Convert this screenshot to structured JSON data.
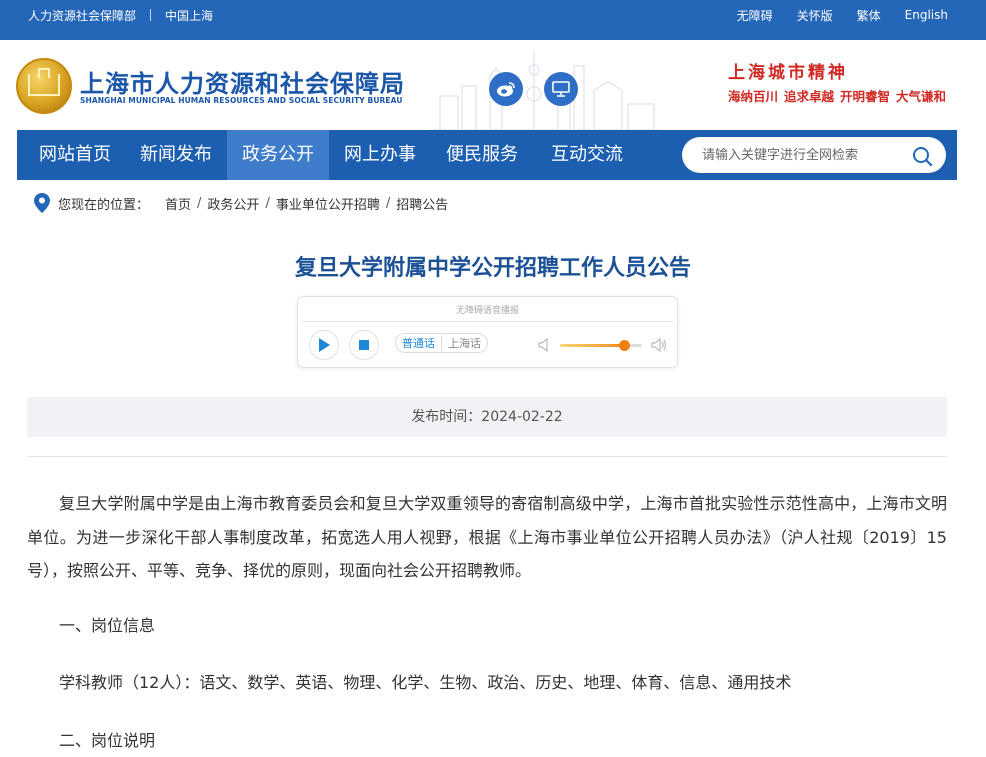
{
  "topbar": {
    "left": [
      "人力资源社会保障部",
      "中国上海"
    ],
    "right": [
      "无障碍",
      "关怀版",
      "繁体",
      "English"
    ]
  },
  "header": {
    "title": "上海市人力资源和社会保障局",
    "subtitle": "SHANGHAI MUNICIPAL HUMAN RESOURCES AND SOCIAL SECURITY BUREAU",
    "spirit_title": "上海城市精神",
    "spirit_items": [
      "海纳百川",
      "追求卓越",
      "开明睿智",
      "大气谦和"
    ]
  },
  "nav": {
    "items": [
      "网站首页",
      "新闻发布",
      "政务公开",
      "网上办事",
      "便民服务",
      "互动交流"
    ],
    "active_index": 2,
    "search_placeholder": "请输入关键字进行全网检索"
  },
  "breadcrumb": {
    "label": "您现在的位置：",
    "items": [
      "首页",
      "政务公开",
      "事业单位公开招聘",
      "招聘公告"
    ]
  },
  "article": {
    "title": "复旦大学附属中学公开招聘工作人员公告",
    "player": {
      "title": "无障碍语音播报",
      "lang_on": "普通话",
      "lang_off": "上海话",
      "volume": 0.78
    },
    "publish": "发布时间：2024-02-22",
    "paragraph1": "复旦大学附属中学是由上海市教育委员会和复旦大学双重领导的寄宿制高级中学，上海市首批实验性示范性高中，上海市文明单位。为进一步深化干部人事制度改革，拓宽选人用人视野，根据《上海市事业单位公开招聘人员办法》（沪人社规〔2019〕15号），按照公开、平等、竞争、择优的原则，现面向社会公开招聘教师。",
    "section1": "一、岗位信息",
    "positions": "学科教师（12人）：语文、数学、英语、物理、化学、生物、政治、历史、地理、体育、信息、通用技术",
    "section2": "二、岗位说明"
  },
  "colors": {
    "topbar": "#2466b8",
    "nav": "#1c5fb0",
    "nav_active": "#3f7dcb",
    "title": "#1d5196",
    "spirit": "#d02a25"
  },
  "icons": [
    "emblem-logo",
    "weibo-icon",
    "screen-icon",
    "search-icon",
    "location-pin-icon",
    "play-icon",
    "stop-icon",
    "volume-low-icon",
    "volume-high-icon"
  ]
}
